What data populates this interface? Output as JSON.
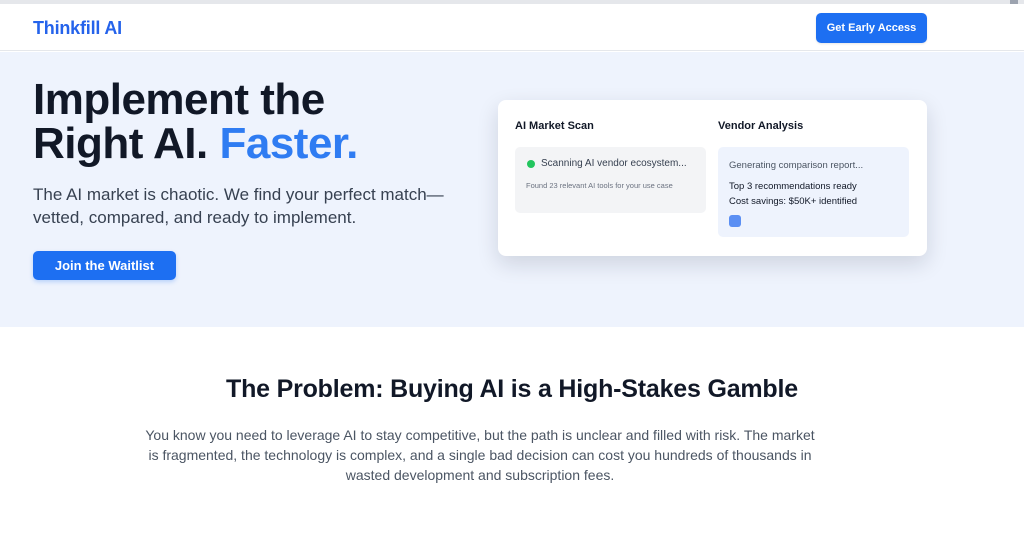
{
  "nav": {
    "brand": "Thinkfill AI",
    "cta_label": "Get Early Access"
  },
  "hero": {
    "title_line1": "Implement the",
    "title_line2_prefix": "Right AI.",
    "title_accent": "Faster.",
    "subtitle": "The AI market is chaotic. We find your perfect match—vetted, compared, and ready to implement.",
    "button_label": "Join the Waitlist"
  },
  "card": {
    "left": {
      "title": "AI Market Scan",
      "status_text": "Scanning AI vendor ecosystem...",
      "detail": "Found 23 relevant AI tools for your use case"
    },
    "right": {
      "title": "Vendor Analysis",
      "status_text": "Generating comparison report...",
      "line1": "Top 3 recommendations ready",
      "line2": "Cost savings: $50K+ identified"
    }
  },
  "problem": {
    "title": "The Problem: Buying AI is a High-Stakes Gamble",
    "body": "You know you need to leverage AI to stay competitive, but the path is unclear and filled with risk. The market is fragmented, the technology is complex, and a single bad decision can cost you hundreds of thousands in wasted development and subscription fees."
  },
  "colors": {
    "brand": "#2563eb",
    "button": "#1d6ff2",
    "accent_text": "#2f7cf2",
    "hero_background": "#eef3fd",
    "status_green": "#22c55e"
  }
}
